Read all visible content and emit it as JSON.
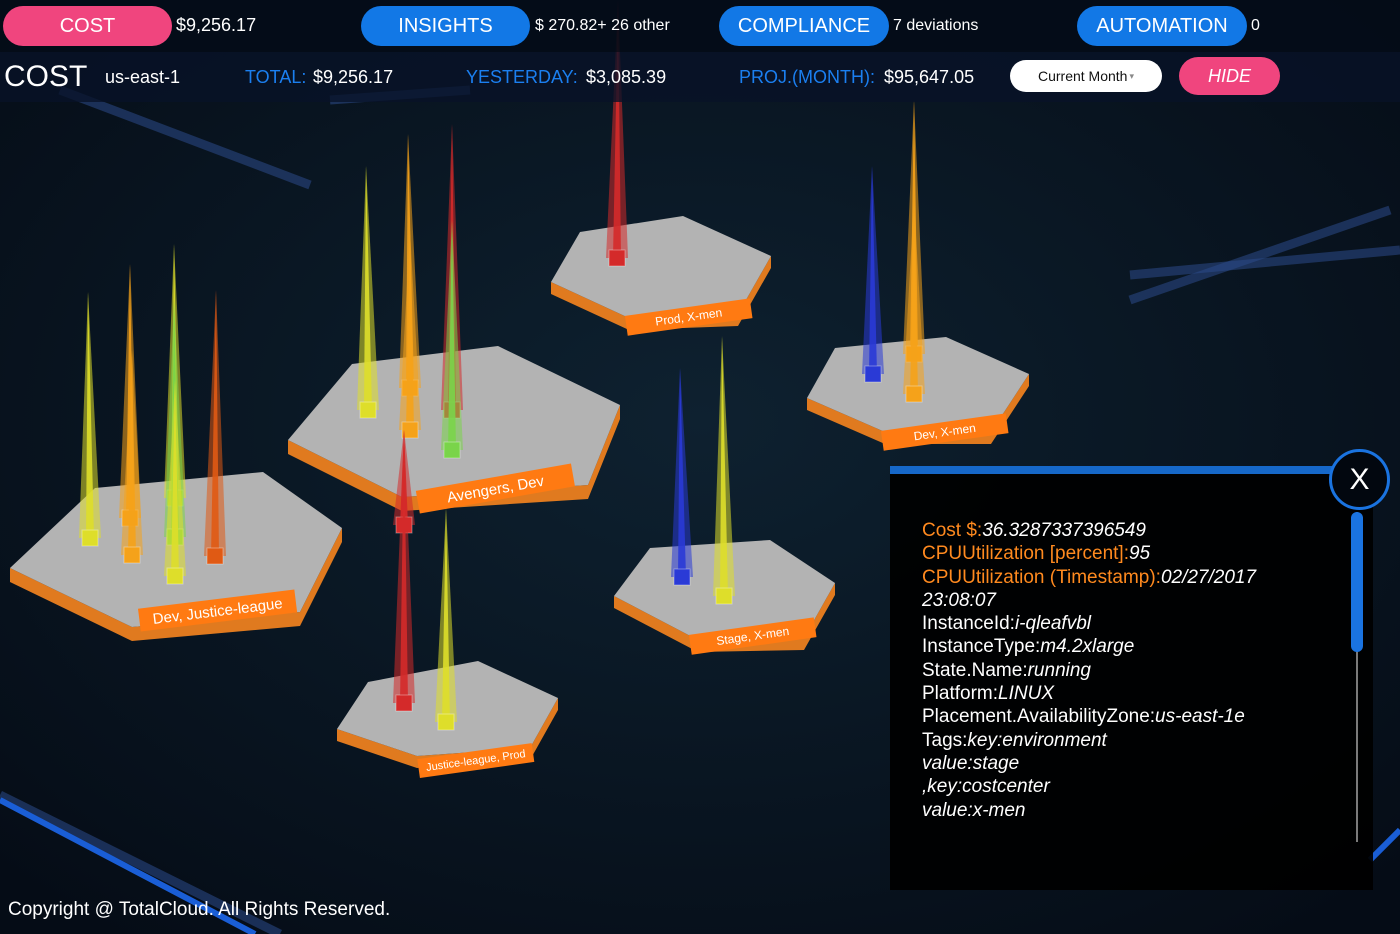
{
  "nav": {
    "cost": {
      "label": "COST",
      "value": "$9,256.17"
    },
    "insights": {
      "label": "INSIGHTS",
      "value": "$ 270.82+ 26 other"
    },
    "compliance": {
      "label": "COMPLIANCE",
      "value": "7 deviations"
    },
    "automation": {
      "label": "AUTOMATION",
      "value": "0"
    }
  },
  "header": {
    "title": "COST",
    "region": "us-east-1",
    "total_label": "TOTAL:",
    "total_value": "$9,256.17",
    "yesterday_label": "YESTERDAY:",
    "yesterday_value": "$3,085.39",
    "proj_label": "PROJ.(MONTH):",
    "proj_value": "$95,647.05",
    "period_select": "Current Month",
    "hide_label": "HIDE"
  },
  "groups": [
    {
      "label": "Dev, Justice-league"
    },
    {
      "label": "Avengers, Dev"
    },
    {
      "label": "Prod, X-men"
    },
    {
      "label": "Dev, X-men"
    },
    {
      "label": "Stage, X-men"
    },
    {
      "label": "Justice-league, Prod"
    }
  ],
  "colors": {
    "brand_pink": "#f0457e",
    "brand_blue": "#1278e6",
    "platform_top": "#b3b3b3",
    "platform_side": "#e07a1f",
    "spike_yellow": "#dede2a",
    "spike_orange": "#f5a21a",
    "spike_red": "#d42a2a",
    "spike_blue": "#2a3ad6",
    "spike_green": "#7ad44a",
    "spike_darkorange": "#e05a14"
  },
  "details": {
    "close_label": "X",
    "rows": [
      {
        "key": "Cost $:",
        "value": "36.3287337396549",
        "highlight": true
      },
      {
        "key": "CPUUtilization [percent]:",
        "value": "95",
        "highlight": true
      },
      {
        "key": "CPUUtilization (Timestamp):",
        "value": "02/27/2017",
        "highlight": true
      },
      {
        "key": "",
        "value": "23:08:07",
        "highlight": false
      },
      {
        "key": "InstanceId:",
        "value": "i-qleafvbl",
        "highlight": false
      },
      {
        "key": "InstanceType:",
        "value": "m4.2xlarge",
        "highlight": false
      },
      {
        "key": "State.Name:",
        "value": "running",
        "highlight": false
      },
      {
        "key": "Platform:",
        "value": "LINUX",
        "highlight": false
      },
      {
        "key": "Placement.AvailabilityZone:",
        "value": "us-east-1e",
        "highlight": false
      },
      {
        "key": "Tags:",
        "value": "key:environment",
        "highlight": false
      },
      {
        "key": "",
        "value": "value:stage",
        "highlight": false
      },
      {
        "key": "",
        "value": ",key:costcenter",
        "highlight": false
      },
      {
        "key": "",
        "value": "value:x-men",
        "highlight": false
      }
    ]
  },
  "footer": {
    "copyright": "Copyright @ TotalCloud. All Rights Reserved."
  }
}
